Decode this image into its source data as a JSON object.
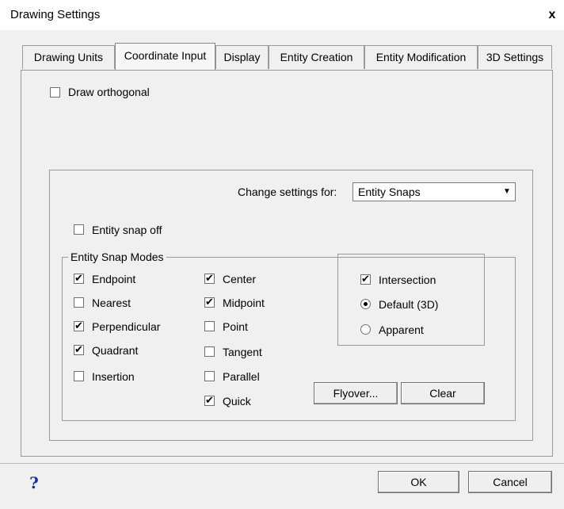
{
  "window": {
    "title": "Drawing Settings",
    "close_label": "x"
  },
  "tabs": [
    {
      "label": "Drawing Units"
    },
    {
      "label": "Coordinate Input"
    },
    {
      "label": "Display"
    },
    {
      "label": "Entity Creation"
    },
    {
      "label": "Entity Modification"
    },
    {
      "label": "3D Settings"
    }
  ],
  "active_tab": "Coordinate Input",
  "draw_orthogonal": {
    "label": "Draw orthogonal",
    "checked": false
  },
  "change_settings": {
    "label": "Change settings for:",
    "value": "Entity Snaps"
  },
  "entity_snap_off": {
    "label": "Entity snap off",
    "checked": false
  },
  "snap_modes": {
    "title": "Entity Snap Modes",
    "col1": [
      {
        "label": "Endpoint",
        "checked": true
      },
      {
        "label": "Nearest",
        "checked": false
      },
      {
        "label": "Perpendicular",
        "checked": true
      },
      {
        "label": "Quadrant",
        "checked": true
      },
      {
        "label": "Insertion",
        "checked": false
      }
    ],
    "col2": [
      {
        "label": "Center",
        "checked": true
      },
      {
        "label": "Midpoint",
        "checked": true
      },
      {
        "label": "Point",
        "checked": false
      },
      {
        "label": "Tangent",
        "checked": false
      },
      {
        "label": "Parallel",
        "checked": false
      },
      {
        "label": "Quick",
        "checked": true
      }
    ],
    "intersection": {
      "label": "Intersection",
      "checked": true
    },
    "radios": [
      {
        "label": "Default (3D)",
        "checked": true
      },
      {
        "label": "Apparent",
        "checked": false
      }
    ],
    "flyover_label": "Flyover...",
    "clear_label": "Clear"
  },
  "footer": {
    "help_label": "?",
    "ok_label": "OK",
    "cancel_label": "Cancel"
  }
}
